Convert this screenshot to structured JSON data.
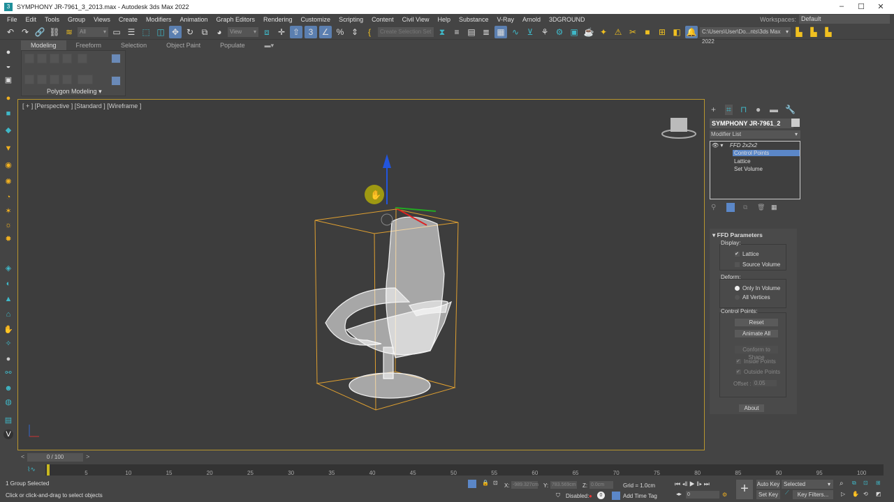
{
  "titlebar": {
    "title": "SYMPHONY JR-7961_3_2013.max - Autodesk 3ds Max 2022"
  },
  "menu": [
    "File",
    "Edit",
    "Tools",
    "Group",
    "Views",
    "Create",
    "Modifiers",
    "Animation",
    "Graph Editors",
    "Rendering",
    "Customize",
    "Scripting",
    "Content",
    "Civil View",
    "Help",
    "Substance",
    "V-Ray",
    "Arnold",
    "3DGROUND"
  ],
  "workspaces": {
    "label": "Workspaces:",
    "value": "Default"
  },
  "toolbar": {
    "filter": "All",
    "ref_coord": "View",
    "selection_set_placeholder": "Create Selection Set",
    "project_path": "C:\\Users\\User\\Do...nts\\3ds Max 2022"
  },
  "ribbon": {
    "tabs": [
      "Modeling",
      "Freeform",
      "Selection",
      "Object Paint",
      "Populate"
    ],
    "panel_label": "Polygon Modeling"
  },
  "viewport": {
    "label": "[ + ] [Perspective ] [Standard ] [Wireframe ]"
  },
  "command_panel": {
    "object_name": "SYMPHONY JR-7961_2",
    "modifier_list": "Modifier List",
    "stack": {
      "modifier": "FFD 2x2x2",
      "items": [
        "Control Points",
        "Lattice",
        "Set Volume"
      ],
      "selected": "Control Points"
    },
    "rollout": {
      "title": "FFD Parameters",
      "display_label": "Display:",
      "lattice": "Lattice",
      "lattice_checked": true,
      "source_volume": "Source Volume",
      "source_volume_checked": false,
      "deform_label": "Deform:",
      "only_in_volume": "Only In Volume",
      "all_vertices": "All Vertices",
      "deform_selected": "Only In Volume",
      "control_points_label": "Control Points:",
      "reset": "Reset",
      "animate_all": "Animate All",
      "conform": "Conform to Shape",
      "inside_points": "Inside Points",
      "outside_points": "Outside Points",
      "offset_label": "Offset :",
      "offset_value": "0.05",
      "about": "About"
    }
  },
  "timeline": {
    "frame": "0 / 100",
    "ticks": [
      "5",
      "10",
      "15",
      "20",
      "25",
      "30",
      "35",
      "40",
      "45",
      "50",
      "55",
      "60",
      "65",
      "70",
      "75",
      "80",
      "85",
      "90",
      "95",
      "100"
    ]
  },
  "status": {
    "selection": "1 Group Selected",
    "prompt": "Click or click-and-drag to select objects",
    "x_label": "X:",
    "x": "-989.327cm",
    "y_label": "Y:",
    "y": "783.569cm",
    "z_label": "Z:",
    "z": "0.0cm",
    "grid": "Grid = 1.0cm",
    "disabled": "Disabled:",
    "add_time_tag": "Add Time Tag",
    "current_frame": "0",
    "auto_key": "Auto Key",
    "set_key": "Set Key",
    "key_mode": "Selected",
    "key_filters": "Key Filters..."
  }
}
